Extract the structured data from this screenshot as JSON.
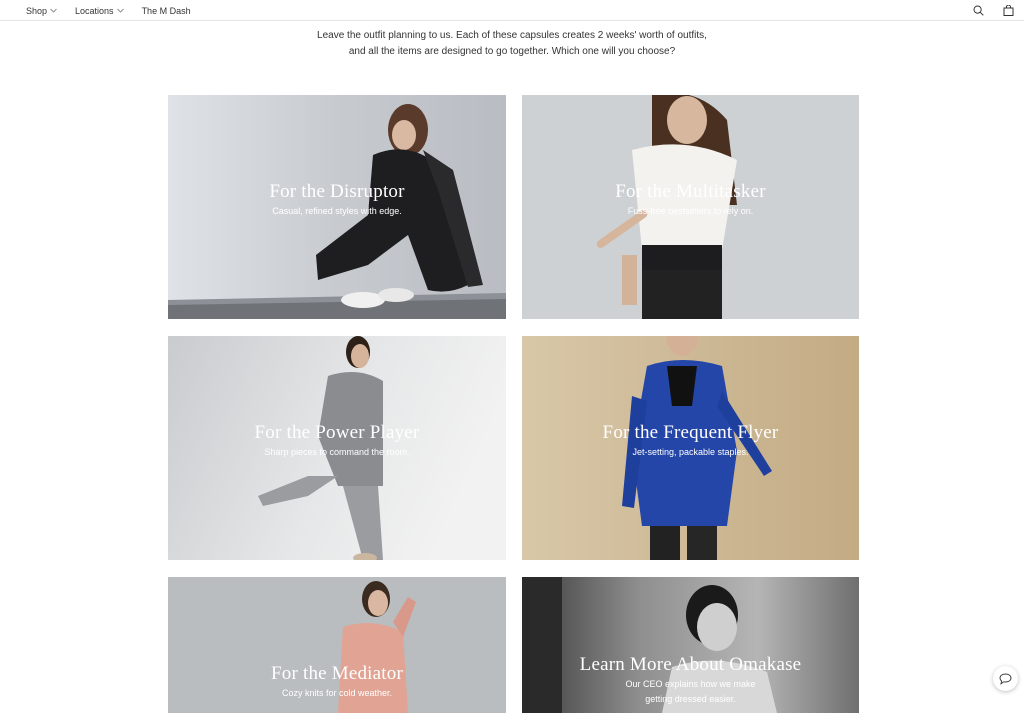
{
  "nav": {
    "items": [
      {
        "label": "Shop",
        "has_dropdown": true
      },
      {
        "label": "Locations",
        "has_dropdown": true
      },
      {
        "label": "The M Dash",
        "has_dropdown": false
      }
    ],
    "icons": [
      "search-icon",
      "shopping-bag-icon"
    ]
  },
  "intro": {
    "line1": "Leave the outfit planning to us. Each of these capsules creates 2 weeks' worth of outfits,",
    "line2": "and all the items are designed to go together. Which one will you choose?"
  },
  "cards": [
    {
      "title": "For the Disruptor",
      "subtitle": "Casual, refined styles with edge."
    },
    {
      "title": "For the Multitasker",
      "subtitle": "Fuss-free bestsellers to rely on."
    },
    {
      "title": "For the Power Player",
      "subtitle": "Sharp pieces to command the room."
    },
    {
      "title": "For the Frequent Flyer",
      "subtitle": "Jet-setting, packable staples."
    },
    {
      "title": "For the Mediator",
      "subtitle": "Cozy knits for cold weather."
    },
    {
      "title": "Learn More About Omakase",
      "subtitle": "Our CEO explains how we make",
      "subtitle2": "getting dressed easier."
    }
  ],
  "colors": {
    "card1_bg": "#c9cdd2",
    "card2_bg": "#cfd3d6",
    "card3_bg": "#d9dadc",
    "card4_bg": "#cdb896",
    "card5_bg": "#b8bcbf",
    "card6_bg": "#8a8a8a"
  },
  "chat": {
    "icon": "chat-bubble-icon"
  }
}
